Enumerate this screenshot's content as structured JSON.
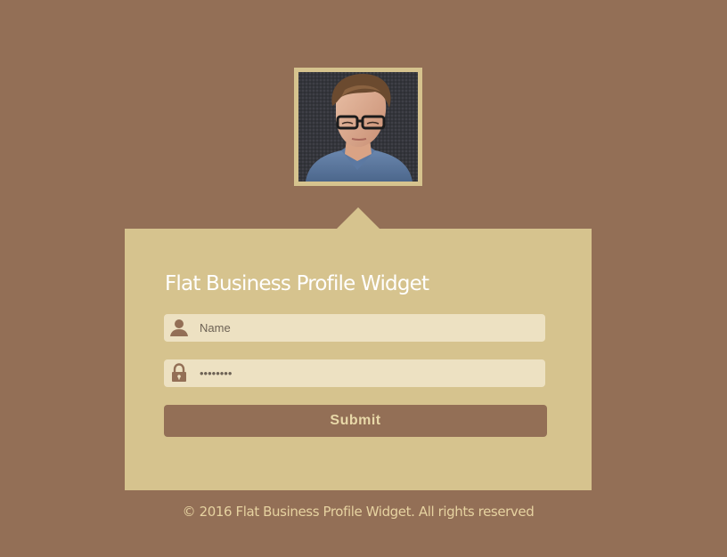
{
  "profile": {
    "photo_alt": "Profile photo"
  },
  "widget": {
    "title": "Flat Business Profile Widget",
    "name_field": {
      "placeholder": "Name",
      "value": "",
      "icon": "user-icon"
    },
    "password_field": {
      "placeholder": "",
      "value": "********",
      "icon": "lock-icon"
    },
    "submit_label": "Submit"
  },
  "footer": {
    "copyright": "© 2016 Flat Business Profile Widget. All rights reserved"
  },
  "colors": {
    "background": "#936f56",
    "card": "#d6c38e",
    "input": "#ede1c2",
    "button": "#936f56",
    "button_text": "#e8d8a8",
    "title": "#ffffff",
    "footer_text": "#e6d2a0",
    "icon": "#936f56"
  }
}
